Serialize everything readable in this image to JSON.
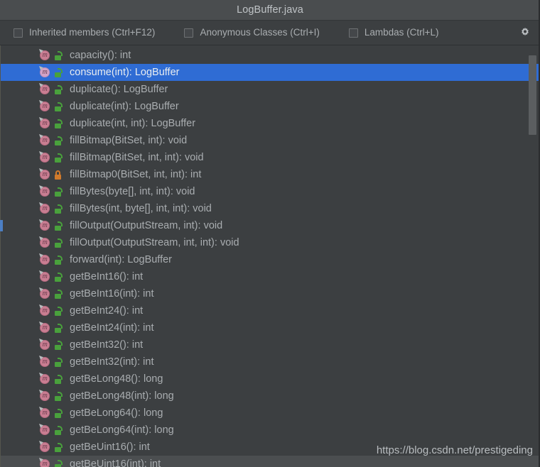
{
  "window": {
    "title": "LogBuffer.java"
  },
  "toolbar": {
    "filters": [
      {
        "label": "Inherited members (Ctrl+F12)",
        "checked": false,
        "name": "inherited-members"
      },
      {
        "label": "Anonymous Classes (Ctrl+I)",
        "checked": false,
        "name": "anonymous-classes"
      },
      {
        "label": "Lambdas (Ctrl+L)",
        "checked": false,
        "name": "lambdas"
      }
    ],
    "settings_icon": "gear-icon"
  },
  "members": [
    {
      "label": "capacity(): int",
      "icon": "method-icon",
      "visibility": "public",
      "selected": false,
      "hovered": false
    },
    {
      "label": "consume(int): LogBuffer",
      "icon": "method-icon",
      "visibility": "public",
      "selected": true,
      "hovered": false
    },
    {
      "label": "duplicate(): LogBuffer",
      "icon": "method-icon",
      "visibility": "public",
      "selected": false,
      "hovered": false
    },
    {
      "label": "duplicate(int): LogBuffer",
      "icon": "method-icon",
      "visibility": "public",
      "selected": false,
      "hovered": false
    },
    {
      "label": "duplicate(int, int): LogBuffer",
      "icon": "method-icon",
      "visibility": "public",
      "selected": false,
      "hovered": false
    },
    {
      "label": "fillBitmap(BitSet, int): void",
      "icon": "method-icon",
      "visibility": "public",
      "selected": false,
      "hovered": false
    },
    {
      "label": "fillBitmap(BitSet, int, int): void",
      "icon": "method-icon",
      "visibility": "public",
      "selected": false,
      "hovered": false
    },
    {
      "label": "fillBitmap0(BitSet, int, int): int",
      "icon": "method-icon",
      "visibility": "private",
      "selected": false,
      "hovered": false
    },
    {
      "label": "fillBytes(byte[], int, int): void",
      "icon": "method-icon",
      "visibility": "public",
      "selected": false,
      "hovered": false
    },
    {
      "label": "fillBytes(int, byte[], int, int): void",
      "icon": "method-icon",
      "visibility": "public",
      "selected": false,
      "hovered": false
    },
    {
      "label": "fillOutput(OutputStream, int): void",
      "icon": "method-icon",
      "visibility": "public",
      "selected": false,
      "hovered": false
    },
    {
      "label": "fillOutput(OutputStream, int, int): void",
      "icon": "method-icon",
      "visibility": "public",
      "selected": false,
      "hovered": false
    },
    {
      "label": "forward(int): LogBuffer",
      "icon": "method-icon",
      "visibility": "public",
      "selected": false,
      "hovered": false
    },
    {
      "label": "getBeInt16(): int",
      "icon": "method-icon",
      "visibility": "public",
      "selected": false,
      "hovered": false
    },
    {
      "label": "getBeInt16(int): int",
      "icon": "method-icon",
      "visibility": "public",
      "selected": false,
      "hovered": false
    },
    {
      "label": "getBeInt24(): int",
      "icon": "method-icon",
      "visibility": "public",
      "selected": false,
      "hovered": false
    },
    {
      "label": "getBeInt24(int): int",
      "icon": "method-icon",
      "visibility": "public",
      "selected": false,
      "hovered": false
    },
    {
      "label": "getBeInt32(): int",
      "icon": "method-icon",
      "visibility": "public",
      "selected": false,
      "hovered": false
    },
    {
      "label": "getBeInt32(int): int",
      "icon": "method-icon",
      "visibility": "public",
      "selected": false,
      "hovered": false
    },
    {
      "label": "getBeLong48(): long",
      "icon": "method-icon",
      "visibility": "public",
      "selected": false,
      "hovered": false
    },
    {
      "label": "getBeLong48(int): long",
      "icon": "method-icon",
      "visibility": "public",
      "selected": false,
      "hovered": false
    },
    {
      "label": "getBeLong64(): long",
      "icon": "method-icon",
      "visibility": "public",
      "selected": false,
      "hovered": false
    },
    {
      "label": "getBeLong64(int): long",
      "icon": "method-icon",
      "visibility": "public",
      "selected": false,
      "hovered": false
    },
    {
      "label": "getBeUint16(): int",
      "icon": "method-icon",
      "visibility": "public",
      "selected": false,
      "hovered": false
    },
    {
      "label": "getBeUint16(int): int",
      "icon": "method-icon",
      "visibility": "public",
      "selected": false,
      "hovered": true
    }
  ],
  "watermark": {
    "text": "https://blog.csdn.net/prestigeding"
  },
  "colors": {
    "titlebar_bg": "#4a4d4f",
    "panel_bg": "#3c3f41",
    "selection_bg": "#2f6cd4",
    "hover_bg": "#4b4e50",
    "text": "#a9adb0",
    "public_icon": "#49a13c",
    "private_icon": "#d07a2b",
    "method_icon": "#c97e92"
  }
}
